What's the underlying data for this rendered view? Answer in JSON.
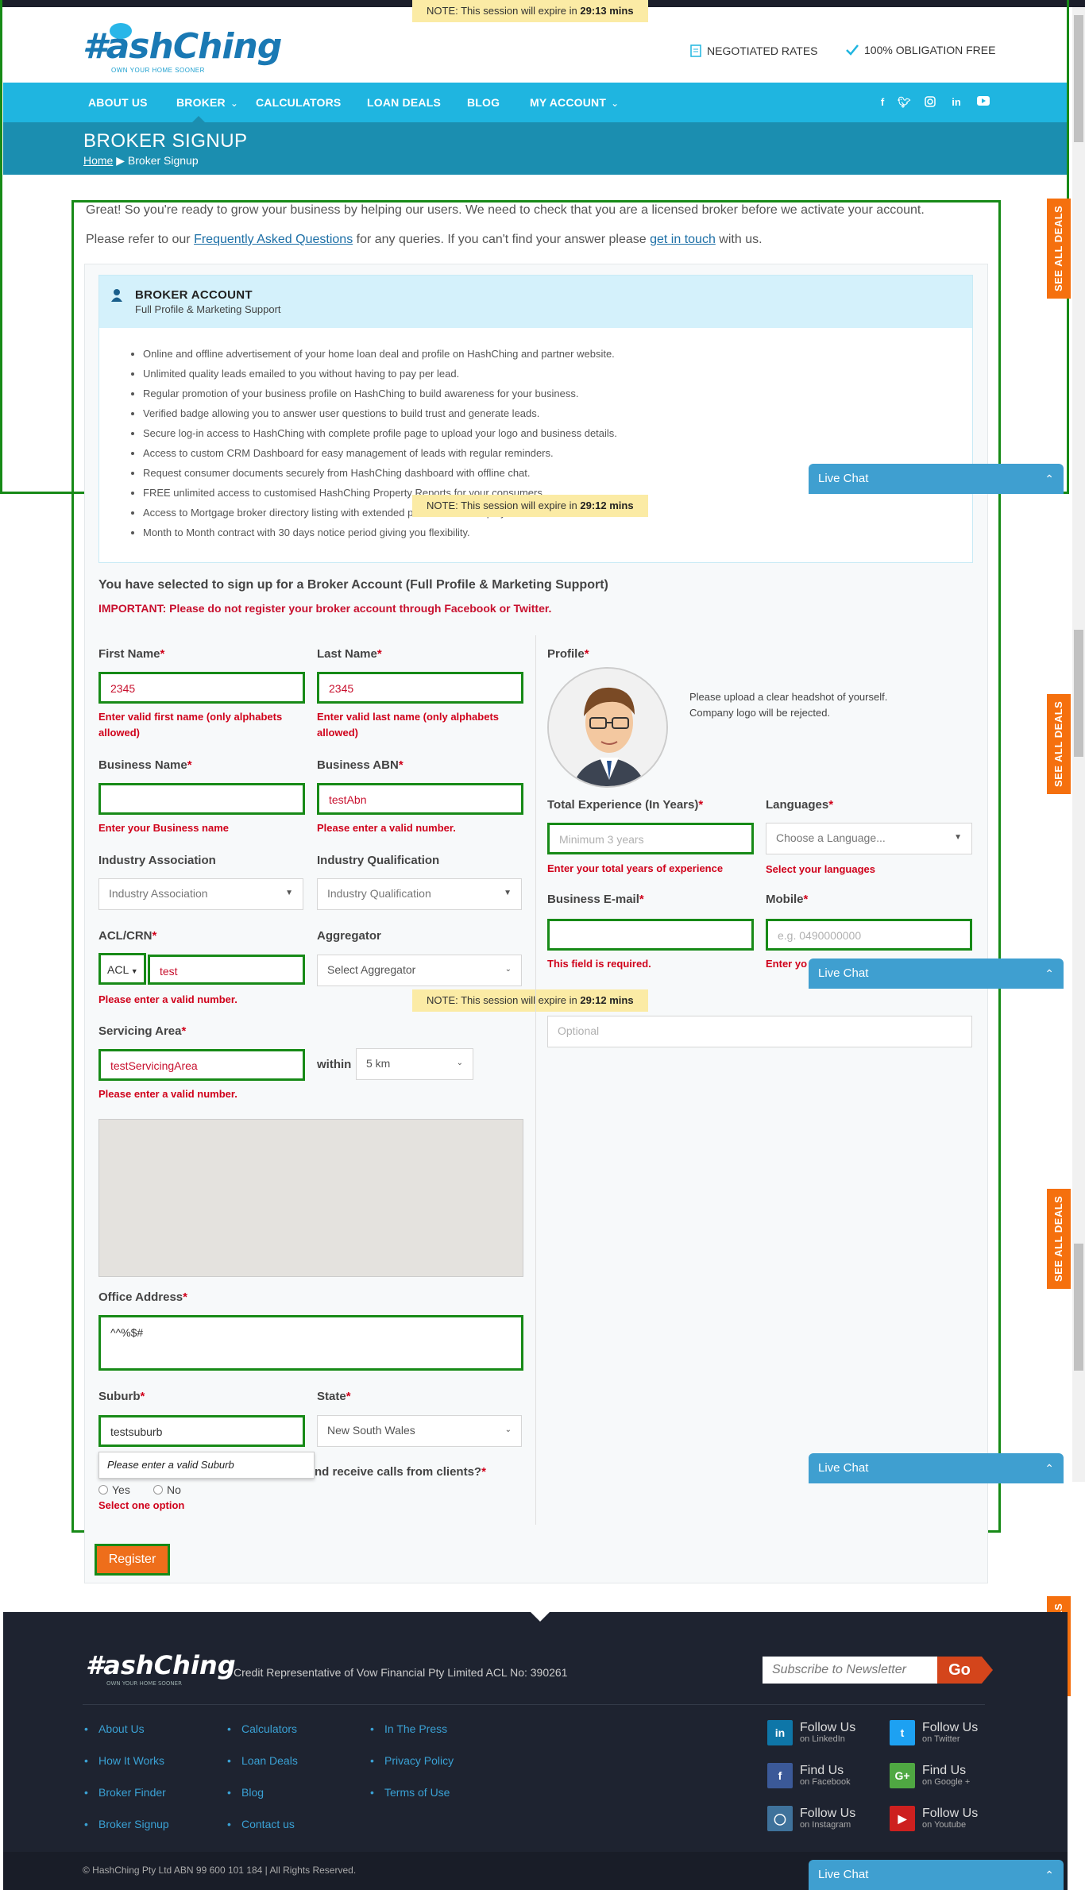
{
  "session_notice": {
    "prefix": "NOTE: This session will expire in ",
    "times": [
      "29:13 mins",
      "29:12 mins",
      "29:12 mins"
    ]
  },
  "header": {
    "logo": "#ashChing",
    "logo_tagline": "OWN YOUR HOME SOONER",
    "features": [
      "NEGOTIATED RATES",
      "100% OBLIGATION FREE"
    ]
  },
  "nav": {
    "items": [
      "ABOUT US",
      "BROKER",
      "CALCULATORS",
      "LOAN DEALS",
      "BLOG",
      "MY ACCOUNT"
    ],
    "social": [
      "f",
      "t",
      "ig",
      "in",
      "yt"
    ]
  },
  "banner": {
    "title": "BROKER SIGNUP",
    "home": "Home",
    "current": "Broker Signup"
  },
  "intro": {
    "line1": "Great! So you're ready to grow your business by helping our users. We need to check that you are a licensed broker before we activate your account.",
    "line2_a": "Please refer to our ",
    "faq_link": "Frequently Asked Questions",
    "line2_b": " for any queries. If you can't find your answer please ",
    "contact_link": "get in touch",
    "line2_c": " with us."
  },
  "account": {
    "title": "BROKER ACCOUNT",
    "subtitle": "Full Profile & Marketing Support",
    "features": [
      "Online and offline advertisement of your home loan deal and profile on HashChing and partner website.",
      "Unlimited quality leads emailed to you without having to pay per lead.",
      "Regular promotion of your business profile on HashChing to build awareness for your business.",
      "Verified badge allowing you to answer user questions to build trust and generate leads.",
      "Secure log-in access to HashChing with complete profile page to upload your logo and business details.",
      "Access to custom CRM Dashboard for easy management of leads with regular reminders.",
      "Request consumer documents securely from HashChing dashboard with offline chat.",
      "FREE unlimited access to customised HashChing Property Reports for your consumers.",
      "Access to Mortgage broker directory listing with extended profile access display.",
      "Month to Month contract with 30 days notice period giving you flexibility."
    ]
  },
  "form": {
    "selected_msg": "You have selected to sign up for a Broker Account (Full Profile & Marketing Support)",
    "important_msg": "IMPORTANT: Please do not register your broker account through Facebook or Twitter.",
    "first_name": {
      "label": "First Name",
      "value": "2345",
      "error": "Enter valid first name (only alphabets allowed)"
    },
    "last_name": {
      "label": "Last Name",
      "value": "2345",
      "error": "Enter valid last name (only alphabets allowed)"
    },
    "business_name": {
      "label": "Business Name",
      "value": "",
      "error": "Enter your Business name"
    },
    "business_abn": {
      "label": "Business ABN",
      "value": "testAbn",
      "error": "Please enter a valid number."
    },
    "industry_association": {
      "label": "Industry Association",
      "placeholder": "Industry Association"
    },
    "industry_qualification": {
      "label": "Industry Qualification",
      "placeholder": "Industry Qualification"
    },
    "acl_crn": {
      "label": "ACL/CRN",
      "type": "ACL",
      "value": "test",
      "error": "Please enter a valid number."
    },
    "aggregator": {
      "label": "Aggregator",
      "placeholder": "Select Aggregator"
    },
    "servicing_area": {
      "label": "Servicing Area",
      "value": "testServicingArea",
      "error": "Please enter a valid number.",
      "within_label": "within",
      "within_value": "5 km"
    },
    "office_address": {
      "label": "Office Address",
      "value": "^^%$#"
    },
    "suburb": {
      "label": "Suburb",
      "value": "testsuburb",
      "tooltip": "Please enter a valid Suburb"
    },
    "state": {
      "label": "State",
      "value": "New South Wales"
    },
    "calls": {
      "label_tail": "nd receive calls from clients?",
      "yes": "Yes",
      "no": "No",
      "error": "Select one option"
    },
    "profile": {
      "label": "Profile",
      "note": "Please upload a clear headshot of yourself. Company logo will be rejected."
    },
    "experience": {
      "label": "Total Experience (In Years)",
      "placeholder": "Minimum 3 years",
      "error": "Enter your total years of experience"
    },
    "languages": {
      "label": "Languages",
      "placeholder": "Choose a Language...",
      "error": "Select your languages"
    },
    "email": {
      "label": "Business E-mail",
      "error": "This field is required."
    },
    "mobile": {
      "label": "Mobile",
      "placeholder": "e.g. 0490000000",
      "error": "Enter yo"
    },
    "optional": {
      "placeholder": "Optional"
    },
    "register": "Register"
  },
  "side": {
    "see_all_deals": "SEE ALL DEALS",
    "live_chat": "Live Chat"
  },
  "footer": {
    "logo": "#ashChing",
    "logo_tagline": "OWN YOUR HOME SOONER",
    "credit": "Credit Representative of Vow Financial Pty Limited ACL No: 390261",
    "newsletter_placeholder": "Subscribe to Newsletter",
    "go": "Go",
    "links_col1": [
      "About Us",
      "How It Works",
      "Broker Finder",
      "Broker Signup"
    ],
    "links_col2": [
      "Calculators",
      "Loan Deals",
      "Blog",
      "Contact us"
    ],
    "links_col3": [
      "In The Press",
      "Privacy Policy",
      "Terms of Use"
    ],
    "follow": [
      {
        "icon": "in",
        "t1": "Follow Us",
        "t2": "on LinkedIn",
        "color": "#0e76a8"
      },
      {
        "icon": "t",
        "t1": "Follow Us",
        "t2": "on Twitter",
        "color": "#1da1f2"
      },
      {
        "icon": "f",
        "t1": "Find Us",
        "t2": "on Facebook",
        "color": "#3b5998"
      },
      {
        "icon": "G+",
        "t1": "Find Us",
        "t2": "on Google +",
        "color": "#4fa842"
      },
      {
        "icon": "ig",
        "t1": "Follow Us",
        "t2": "on Instagram",
        "color": "#3f729b"
      },
      {
        "icon": "yt",
        "t1": "Follow Us",
        "t2": "on Youtube",
        "color": "#cd201f"
      }
    ],
    "copyright": "© HashChing Pty Ltd  ABN 99 600 101 184  |  All Rights Reserved."
  }
}
